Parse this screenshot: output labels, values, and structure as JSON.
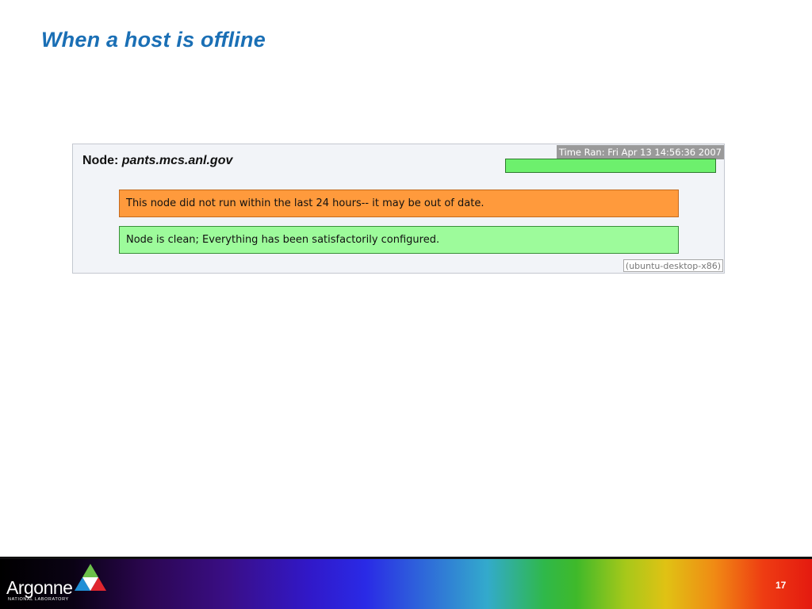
{
  "slide": {
    "title": "When a host is offline",
    "page_number": "17"
  },
  "node": {
    "label": "Node:",
    "hostname": "pants.mcs.anl.gov",
    "time_ran": "Time Ran: Fri Apr 13 14:56:36 2007",
    "status_color": "#6df06d",
    "platform": "(ubuntu-desktop-x86)"
  },
  "messages": [
    {
      "text": "This node did not run within the last 24 hours-- it may be out of date.",
      "color": "#ff9a3c"
    },
    {
      "text": "Node is clean; Everything has been satisfactorily configured.",
      "color": "#9dfb9b"
    }
  ],
  "footer": {
    "logo_word": "Argonne",
    "logo_sub": "NATIONAL LABORATORY"
  }
}
